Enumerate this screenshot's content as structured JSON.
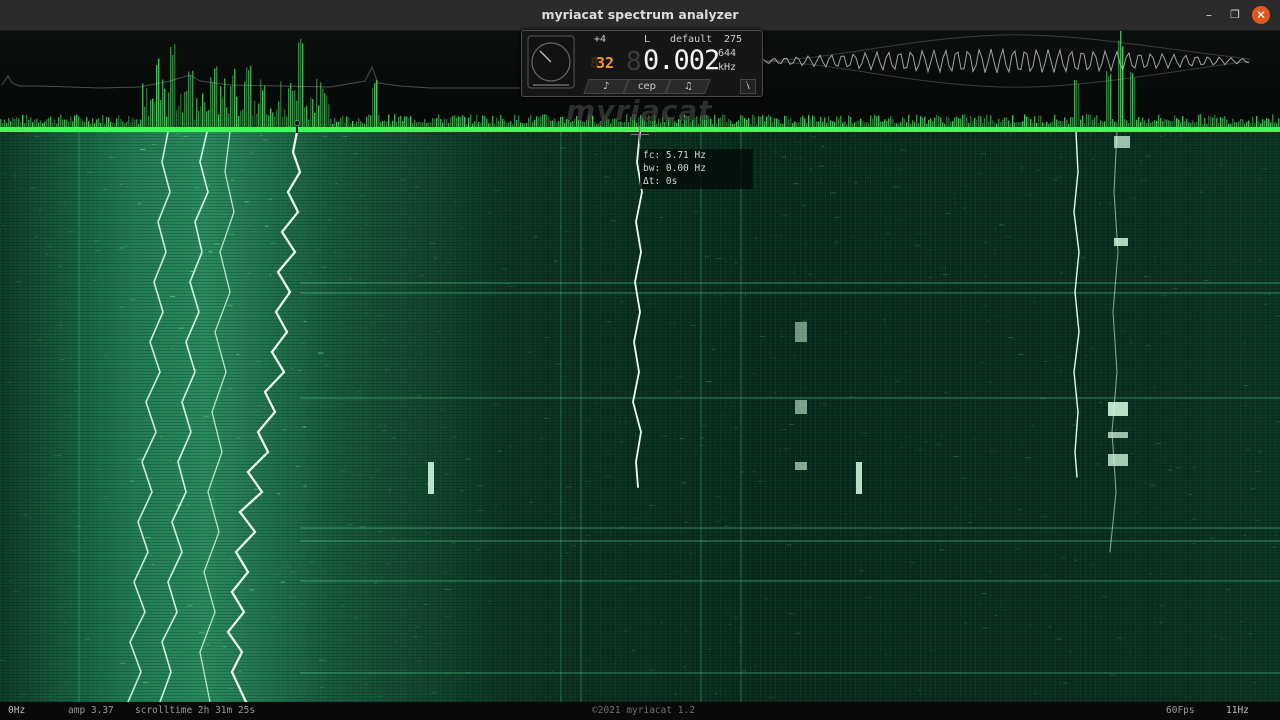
{
  "window": {
    "title": "myriacat spectrum analyzer"
  },
  "window_controls": {
    "minimize": "–",
    "maximize": "❐",
    "close": "✕"
  },
  "panel": {
    "gain": "+4",
    "channel": "L",
    "preset": "default",
    "count": "275",
    "zoom_ghost": "8",
    "zoom": "32",
    "zoom_shadow": "8",
    "frequency": "0.002",
    "frequency_sub": "644",
    "unit": "kHz",
    "tabs": [
      "♪",
      "cep",
      "♫",
      "i"
    ]
  },
  "brand": "myriacat",
  "readout": {
    "fc": "fc: 5.71 Hz",
    "bw": "bw: 0.00 Hz",
    "dt": "Δt: 0s"
  },
  "status": {
    "freq_min": "0Hz",
    "amp": "amp 3.37",
    "scrolltime": "scrolltime 2h 31m 25s",
    "copyright": "©2021 myriacat 1.2",
    "fps": "60Fps",
    "freq_max": "11Hz"
  },
  "colors": {
    "spectrum": "#3dff57",
    "waterfall_bg": "#0c3423",
    "trace": "#e8fff0",
    "accent_orange": "#f09a28",
    "close_button": "#e2561f"
  }
}
